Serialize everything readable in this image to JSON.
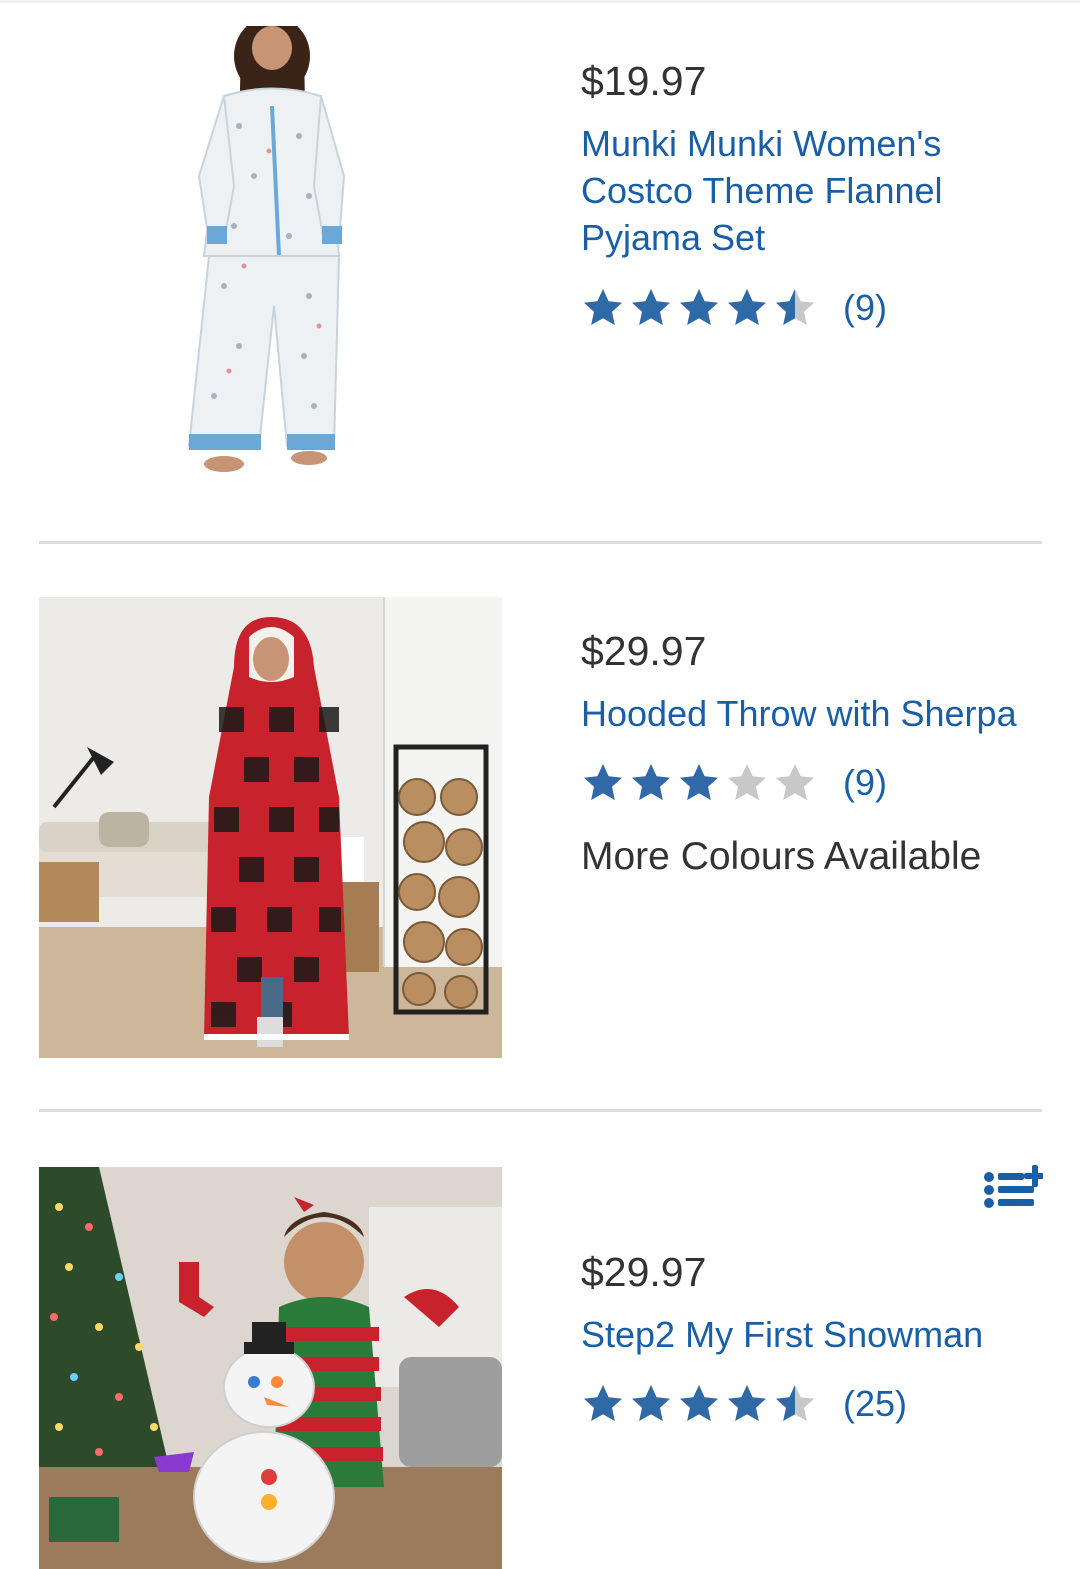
{
  "colors": {
    "link": "#1a5fa6",
    "star_filled": "#2f6aa6",
    "star_empty": "#c8c8c8"
  },
  "products": [
    {
      "price": "$19.97",
      "title": "Munki Munki Women's Costco Theme Flannel Pyjama Set",
      "rating": 4.5,
      "review_count": "(9)",
      "image": "woman in white patterned flannel pyjamas"
    },
    {
      "price": "$29.97",
      "title": "Hooded Throw with Sherpa",
      "rating": 3,
      "review_count": "(9)",
      "extra": "More Colours Available",
      "image": "woman wrapped in red buffalo-check hooded throw in living room"
    },
    {
      "price": "$29.97",
      "title": "Step2 My First Snowman",
      "rating": 4.5,
      "review_count": "(25)",
      "image": "toddler playing with toy snowman by christmas tree"
    }
  ],
  "icons": {
    "add_to_list": "list-add-icon"
  }
}
